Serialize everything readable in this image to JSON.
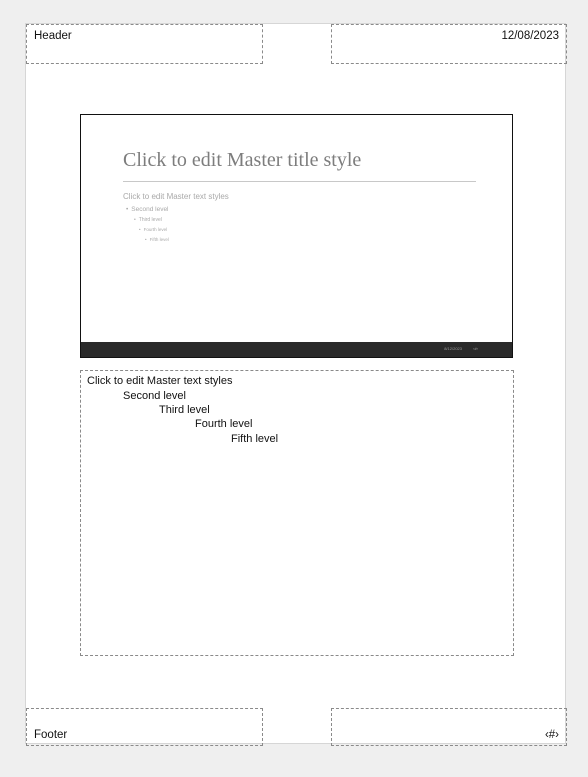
{
  "header": {
    "text": "Header"
  },
  "date": {
    "text": "12/08/2023"
  },
  "footer": {
    "text": "Footer"
  },
  "page_number": {
    "text": "‹#›"
  },
  "slide_thumbnail": {
    "title": "Click to edit Master title style",
    "levels": [
      "Click to edit Master text styles",
      "Second level",
      "Third level",
      "Fourth level",
      "Fifth level"
    ],
    "footer_date": "8/12/2023",
    "footer_number": "‹#›",
    "footer_bar_color": "#2a2a2a"
  },
  "notes": {
    "levels": [
      "Click to edit Master text styles",
      "Second level",
      "Third level",
      "Fourth level",
      "Fifth level"
    ]
  }
}
